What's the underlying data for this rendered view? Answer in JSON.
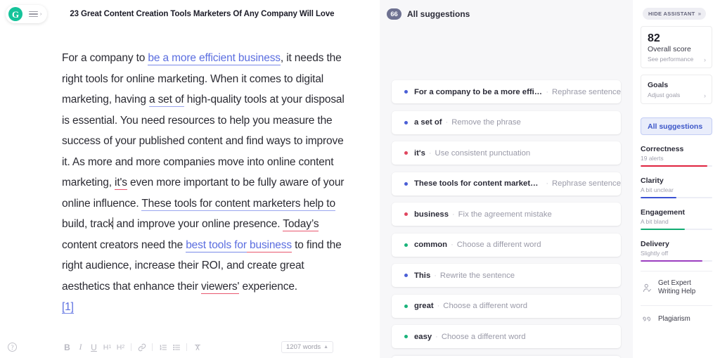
{
  "editor": {
    "logo_letter": "G",
    "menu_caret": "›",
    "doc_title": "23 Great Content Creation Tools Marketers Of Any Company Will Love",
    "paragraph": {
      "p1": "For a company to ",
      "s_clarity_1": "be a more efficient business",
      "p2": ", it needs the right tools for online marketing. When it comes to digital marketing, having ",
      "s_clarity_2": "a set of",
      "p3": " high-quality tools at your disposal is essential. You need resources to help you measure the success of your published content and find ways to improve it. As more and more companies move into online content marketing, ",
      "s_corr_1": "it's",
      "p4": " even more important to be fully aware of your online influence. ",
      "s_clarity_3": "These tools for content marketers help to",
      "p5": " build, track",
      "p6": " and improve your online presence. ",
      "s_corr_2": "Today’s",
      "p7": " content creators need the ",
      "s_link_1": "best tools for",
      "s_both_1": " business",
      "p8": " to find the right audience, increase their ROI, and create great aesthetics that enhance their ",
      "s_corr_3": "viewers'",
      "p9": " experience.",
      "reference": "[1]"
    },
    "toolbar": {
      "help_label": "?",
      "bold": "B",
      "italic": "I",
      "underline": "U",
      "h1": "H",
      "h1_sub": "1",
      "h2": "H",
      "h2_sub": "2",
      "link_icon": "link-icon",
      "ordered_list_icon": "ordered-list-icon",
      "bullet_list_icon": "bullet-list-icon",
      "clear_format_icon": "clear-formatting-icon",
      "word_count": "1207 words",
      "word_count_caret": "▲"
    }
  },
  "suggestions": {
    "badge_count": "66",
    "title": "All suggestions",
    "items": [
      {
        "text": "For a company to be a more effici…",
        "action": "Rephrase sentence",
        "dot": "#4a5fd6"
      },
      {
        "text": "a set of",
        "action": "Remove the phrase",
        "dot": "#4a5fd6"
      },
      {
        "text": "it's",
        "action": "Use consistent punctuation",
        "dot": "#e0465f"
      },
      {
        "text": "These tools for content marketers…",
        "action": "Rephrase sentence",
        "dot": "#4a5fd6"
      },
      {
        "text": "business",
        "action": "Fix the agreement mistake",
        "dot": "#e0465f"
      },
      {
        "text": "common",
        "action": "Choose a different word",
        "dot": "#19b37a"
      },
      {
        "text": "This",
        "action": "Rewrite the sentence",
        "dot": "#4a5fd6"
      },
      {
        "text": "great",
        "action": "Choose a different word",
        "dot": "#19b37a"
      },
      {
        "text": "easy",
        "action": "Choose a different word",
        "dot": "#19b37a"
      }
    ],
    "separator": "·"
  },
  "sidebar": {
    "hide_assistant": "HIDE ASSISTANT",
    "hide_assistant_chevron": "»",
    "score": {
      "value": "82",
      "label": "Overall score",
      "sub": "See performance",
      "chevron": "›"
    },
    "goals": {
      "title": "Goals",
      "sub": "Adjust goals",
      "chevron": "›"
    },
    "all_suggestions_label": "All suggestions",
    "categories": [
      {
        "name": "Correctness",
        "sub": "19 alerts",
        "color": "#e0243f",
        "pct": 93
      },
      {
        "name": "Clarity",
        "sub": "A bit unclear",
        "color": "#3b52d4",
        "pct": 50
      },
      {
        "name": "Engagement",
        "sub": "A bit bland",
        "color": "#11ab72",
        "pct": 62
      },
      {
        "name": "Delivery",
        "sub": "Slightly off",
        "color": "#9b3ec0",
        "pct": 86
      }
    ],
    "links": [
      {
        "label": "Get Expert Writing Help",
        "icon": "expert-writer-icon"
      },
      {
        "label": "Plagiarism",
        "icon": "quotation-marks-icon"
      }
    ]
  }
}
